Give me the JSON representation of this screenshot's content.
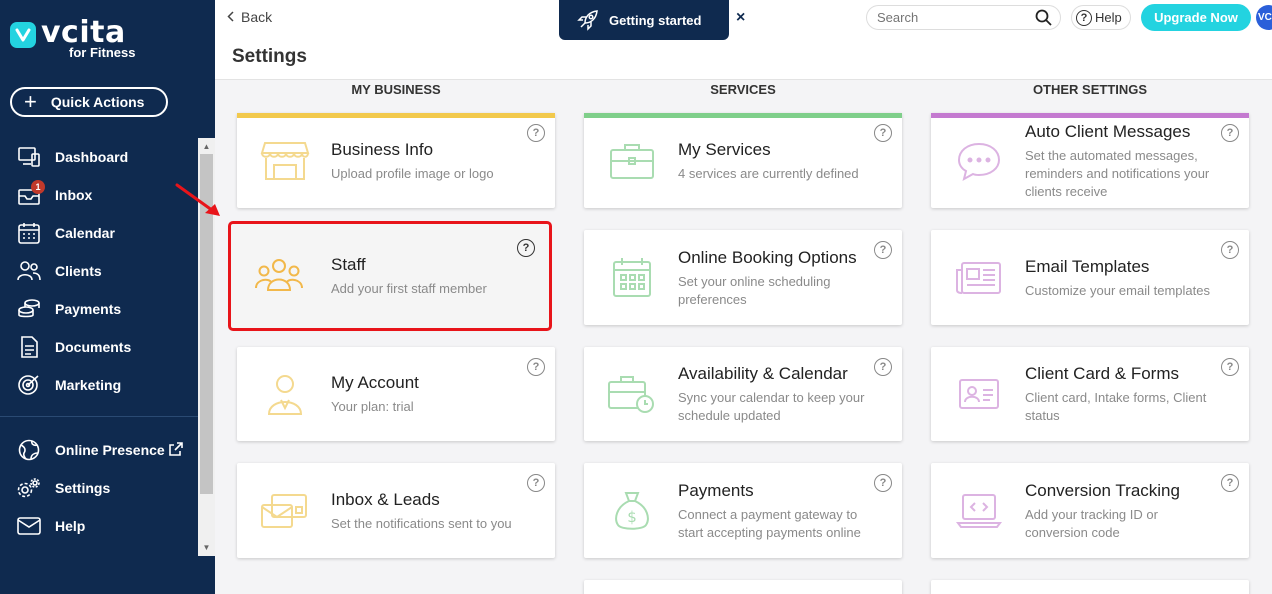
{
  "app": {
    "logo_name": "vcita",
    "logo_sub": "for Fitness",
    "quick_actions": "Quick Actions"
  },
  "sidebar": {
    "items": [
      {
        "label": "Dashboard",
        "icon": "dashboard-icon"
      },
      {
        "label": "Inbox",
        "icon": "inbox-icon",
        "badge": "1"
      },
      {
        "label": "Calendar",
        "icon": "calendar-icon"
      },
      {
        "label": "Clients",
        "icon": "clients-icon"
      },
      {
        "label": "Payments",
        "icon": "payments-icon"
      },
      {
        "label": "Documents",
        "icon": "documents-icon"
      },
      {
        "label": "Marketing",
        "icon": "marketing-icon"
      }
    ],
    "items2": [
      {
        "label": "Online Presence",
        "icon": "globe-icon"
      },
      {
        "label": "Settings",
        "icon": "settings-icon"
      },
      {
        "label": "Help",
        "icon": "help-mail-icon"
      }
    ]
  },
  "topbar": {
    "back": "Back",
    "getting_started": "Getting started",
    "close": "×",
    "search_placeholder": "Search",
    "help": "Help",
    "upgrade": "Upgrade Now",
    "avatar": "VC"
  },
  "page": {
    "title": "Settings"
  },
  "columns": {
    "business": "MY BUSINESS",
    "services": "SERVICES",
    "other": "OTHER SETTINGS"
  },
  "cards": {
    "business_info": {
      "title": "Business Info",
      "desc": "Upload profile image or logo"
    },
    "staff": {
      "title": "Staff",
      "desc": "Add your first staff member"
    },
    "my_account": {
      "title": "My Account",
      "desc": "Your plan: trial"
    },
    "inbox_leads": {
      "title": "Inbox & Leads",
      "desc": "Set the notifications sent to you"
    },
    "my_services": {
      "title": "My Services",
      "desc": "4 services are currently defined"
    },
    "online_booking": {
      "title": "Online Booking Options",
      "desc": "Set your online scheduling preferences"
    },
    "availability": {
      "title": "Availability & Calendar",
      "desc": "Sync your calendar to keep your schedule updated"
    },
    "payments": {
      "title": "Payments",
      "desc": "Connect a payment gateway to start accepting payments online"
    },
    "auto_messages": {
      "title": "Auto Client Messages",
      "desc": "Set the automated messages, reminders and notifications your clients receive"
    },
    "email_templates": {
      "title": "Email Templates",
      "desc": "Customize your email templates"
    },
    "client_card": {
      "title": "Client Card & Forms",
      "desc": "Client card, Intake forms, Client status"
    },
    "conversion": {
      "title": "Conversion Tracking",
      "desc": "Add your tracking ID or conversion code"
    }
  },
  "help_mark": "?",
  "colors": {
    "sidebar_bg": "#0f2a4f",
    "accent": "#23d3e0",
    "business_line": "#f2c94c",
    "services_line": "#7fcf8a",
    "other_line": "#c47ad0",
    "highlight": "#e8141a"
  }
}
